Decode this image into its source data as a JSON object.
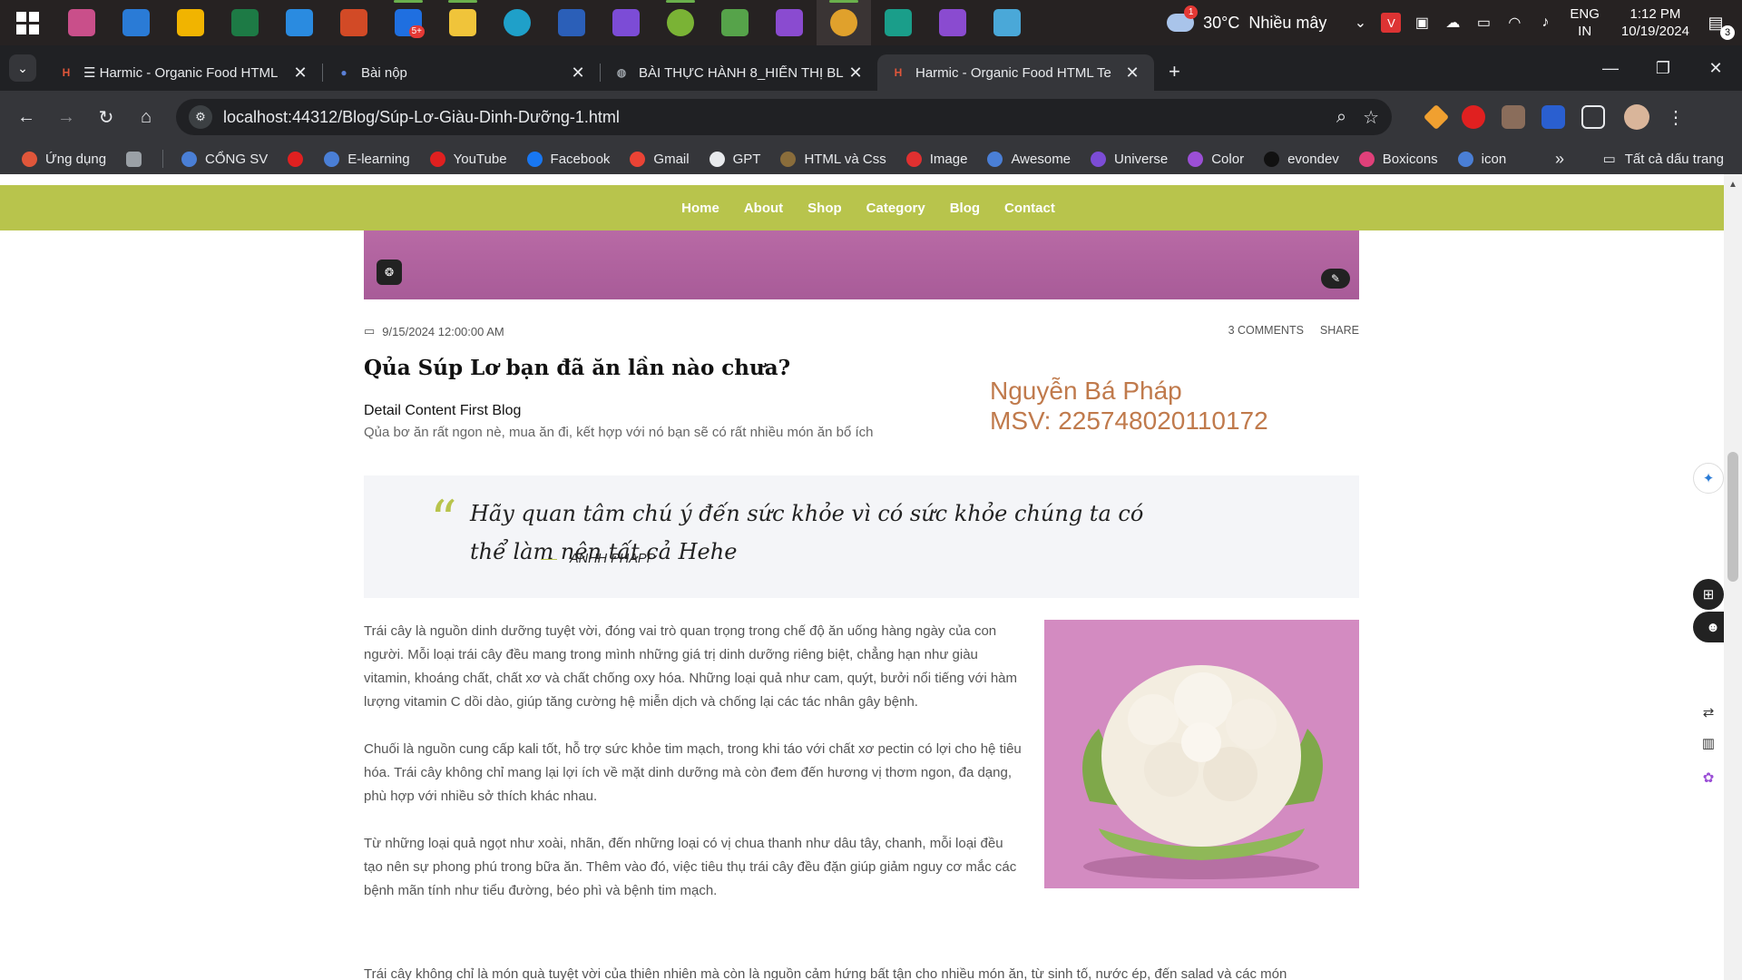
{
  "taskbar": {
    "apps": [
      {
        "name": "snipping-tool",
        "color": "#c94f8a"
      },
      {
        "name": "mail",
        "color": "#2a7bd6"
      },
      {
        "name": "microsoft-store",
        "color": "#f1b400"
      },
      {
        "name": "excel",
        "color": "#1d7a45"
      },
      {
        "name": "vscode",
        "color": "#2a8be0"
      },
      {
        "name": "powerpoint",
        "color": "#d24a26"
      },
      {
        "name": "zalo",
        "color": "#1f6fe0"
      },
      {
        "name": "file-explorer",
        "color": "#f0c43a"
      },
      {
        "name": "edge",
        "color": "#1fa0c9"
      },
      {
        "name": "word",
        "color": "#2b5fb8"
      },
      {
        "name": "visual-studio",
        "color": "#7c4cd6"
      },
      {
        "name": "snip-tool-green",
        "color": "#7ab335"
      },
      {
        "name": "check-app",
        "color": "#56a34a"
      },
      {
        "name": "visual-studio-preview",
        "color": "#8a4bd0"
      },
      {
        "name": "chrome",
        "color": "#e0a12c"
      },
      {
        "name": "git-kraken",
        "color": "#1a9e8a"
      },
      {
        "name": "visual-studio-preview-2",
        "color": "#8a4bd0"
      },
      {
        "name": "paint",
        "color": "#4aa8d8"
      }
    ],
    "zalo_badge": "5+",
    "weather": {
      "temp": "30°C",
      "desc": "Nhiều mây",
      "badge": "1"
    },
    "lang": [
      "ENG",
      "IN"
    ],
    "time": "1:12 PM",
    "date": "10/19/2024",
    "notifications": "3"
  },
  "tabs": [
    {
      "title": "☰ Harmic - Organic Food HTML",
      "fav": "H",
      "fav_color": "#e0563a",
      "active": false
    },
    {
      "title": "Bài nộp",
      "fav": "●",
      "fav_color": "#5a7fd6",
      "active": false
    },
    {
      "title": "BÀI THỰC HÀNH 8_HIỂN THỊ BL",
      "fav": "◍",
      "fav_color": "#9aa0a6",
      "active": false
    },
    {
      "title": "Harmic - Organic Food HTML Te",
      "fav": "H",
      "fav_color": "#e0563a",
      "active": true
    }
  ],
  "toolbar": {
    "url": "localhost:44312/Blog/Súp-Lơ-Giàu-Dinh-Dưỡng-1.html"
  },
  "bookmarks": [
    {
      "label": "Ứng dụng",
      "color": "#e0563a"
    },
    {
      "label": "",
      "color": "#9aa0a6"
    },
    {
      "label": "CỔNG SV",
      "color": "#4a7fd6"
    },
    {
      "label": "",
      "color": "#e02020"
    },
    {
      "label": "E-learning",
      "color": "#4a7fd6"
    },
    {
      "label": "YouTube",
      "color": "#e02020"
    },
    {
      "label": "Facebook",
      "color": "#1877f2"
    },
    {
      "label": "Gmail",
      "color": "#ea4335"
    },
    {
      "label": "GPT",
      "color": "#e8eaed"
    },
    {
      "label": "HTML và Css",
      "color": "#8a6d3b"
    },
    {
      "label": "Image",
      "color": "#e03030"
    },
    {
      "label": "Awesome",
      "color": "#4a7fd6"
    },
    {
      "label": "Universe",
      "color": "#7c4cd6"
    },
    {
      "label": "Color",
      "color": "#9b4fd6"
    },
    {
      "label": "evondev",
      "color": "#111111"
    },
    {
      "label": "Boxicons",
      "color": "#e0407a"
    },
    {
      "label": "icon",
      "color": "#4a7fd6"
    }
  ],
  "bookmarks_all": "Tất cả dấu trang",
  "site": {
    "nav": [
      "Home",
      "About",
      "Shop",
      "Category",
      "Blog",
      "Contact"
    ],
    "post": {
      "date": "9/15/2024 12:00:00 AM",
      "comments": "3 COMMENTS",
      "share": "SHARE",
      "title": "Qủa Súp Lơ bạn đã ăn lần nào chưa?",
      "detail": "Detail Content First Blog",
      "description": "Qủa bơ ăn rất ngon nè, mua ăn đi, kết hợp với nó bạn sẽ có rất nhiều món ăn bổ ích"
    },
    "author": {
      "name": "Nguyễn Bá Pháp",
      "msv": "MSV: 225748020110172"
    },
    "quote": {
      "text": "Hãy quan tâm chú ý đến sức khỏe vì có sức khỏe chúng ta có thể làm nên tất cả Hehe",
      "author": "ANHH PHAPP"
    },
    "paragraphs": [
      "Trái cây là nguồn dinh dưỡng tuyệt vời, đóng vai trò quan trọng trong chế độ ăn uống hàng ngày của con người. Mỗi loại trái cây đều mang trong mình những giá trị dinh dưỡng riêng biệt, chẳng hạn như giàu vitamin, khoáng chất, chất xơ và chất chống oxy hóa. Những loại quả như cam, quýt, bưởi nổi tiếng với hàm lượng vitamin C dồi dào, giúp tăng cường hệ miễn dịch và chống lại các tác nhân gây bệnh.",
      "Chuối là nguồn cung cấp kali tốt, hỗ trợ sức khỏe tim mạch, trong khi táo với chất xơ pectin có lợi cho hệ tiêu hóa. Trái cây không chỉ mang lại lợi ích về mặt dinh dưỡng mà còn đem đến hương vị thơm ngon, đa dạng, phù hợp với nhiều sở thích khác nhau.",
      "Từ những loại quả ngọt như xoài, nhãn, đến những loại có vị chua thanh như dâu tây, chanh, mỗi loại đều tạo nên sự phong phú trong bữa ăn. Thêm vào đó, việc tiêu thụ trái cây đều đặn giúp giảm nguy cơ mắc các bệnh mãn tính như tiểu đường, béo phì và bệnh tim mạch.",
      "Trái cây không chỉ là món quà tuyệt vời của thiên nhiên mà còn là nguồn cảm hứng bất tận cho nhiều món ăn, từ sinh tố, nước ép, đến salad và các món"
    ]
  }
}
